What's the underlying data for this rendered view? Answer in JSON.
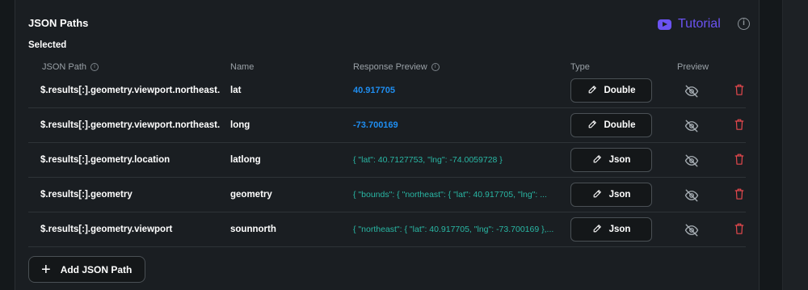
{
  "section": {
    "title": "JSON Paths",
    "selected_label": "Selected",
    "tutorial_label": "Tutorial",
    "info_glyph": "i"
  },
  "columns": {
    "path": "JSON Path",
    "name": "Name",
    "preview": "Response Preview",
    "type": "Type",
    "preview_toggle": "Preview"
  },
  "rows": [
    {
      "path": "$.results[:].geometry.viewport.northeast.",
      "name": "lat",
      "response": "40.917705",
      "type": "Double"
    },
    {
      "path": "$.results[:].geometry.viewport.northeast.",
      "name": "long",
      "response": "-73.700169",
      "type": "Double"
    },
    {
      "path": "$.results[:].geometry.location",
      "name": "latlong",
      "response": "{  \"lat\": 40.7127753,  \"lng\": -74.0059728 }",
      "type": "Json"
    },
    {
      "path": "$.results[:].geometry",
      "name": "geometry",
      "response": "{  \"bounds\": {   \"northeast\": {    \"lat\": 40.917705,    \"lng\": ...",
      "type": "Json"
    },
    {
      "path": "$.results[:].geometry.viewport",
      "name": "sounnorth",
      "response": "{  \"northeast\": {   \"lat\": 40.917705,   \"lng\": -73.700169  },...",
      "type": "Json"
    }
  ],
  "actions": {
    "add_label": "Add JSON Path",
    "add_glyph": "+"
  },
  "colors": {
    "accent": "#6b53f2",
    "number_preview": "#1f8ef1",
    "json_preview": "#29b7a4",
    "delete": "#e5484d"
  },
  "icons": {
    "tutorial": "youtube-icon",
    "info": "info-icon",
    "edit": "pencil-icon",
    "preview": "eye-off-icon",
    "delete": "trash-icon",
    "add": "plus-icon"
  }
}
